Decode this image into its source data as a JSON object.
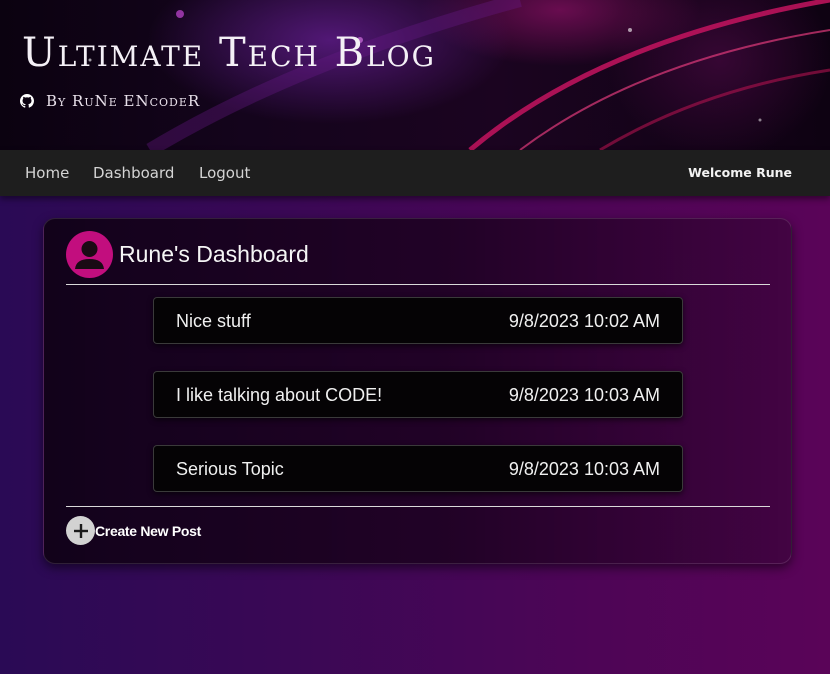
{
  "header": {
    "title": "Ultimate Tech Blog",
    "byline": "By RuNe ENcodeR",
    "github_icon": "github-icon"
  },
  "nav": {
    "links": [
      {
        "label": "Home"
      },
      {
        "label": "Dashboard"
      },
      {
        "label": "Logout"
      }
    ],
    "welcome": "Welcome Rune"
  },
  "dashboard": {
    "title": "Rune's Dashboard",
    "avatar_icon": "user-avatar-icon",
    "avatar_color": "#c20e7e",
    "posts": [
      {
        "title": "Nice stuff",
        "date": "9/8/2023 10:02 AM"
      },
      {
        "title": "I like talking about CODE!",
        "date": "9/8/2023 10:03 AM"
      },
      {
        "title": "Serious Topic",
        "date": "9/8/2023 10:03 AM"
      }
    ],
    "create_label": "Create New Post",
    "create_icon": "plus-icon"
  },
  "colors": {
    "navbar": "#1e1e1e",
    "accent": "#c20e7e",
    "post_bg": "#050305"
  }
}
